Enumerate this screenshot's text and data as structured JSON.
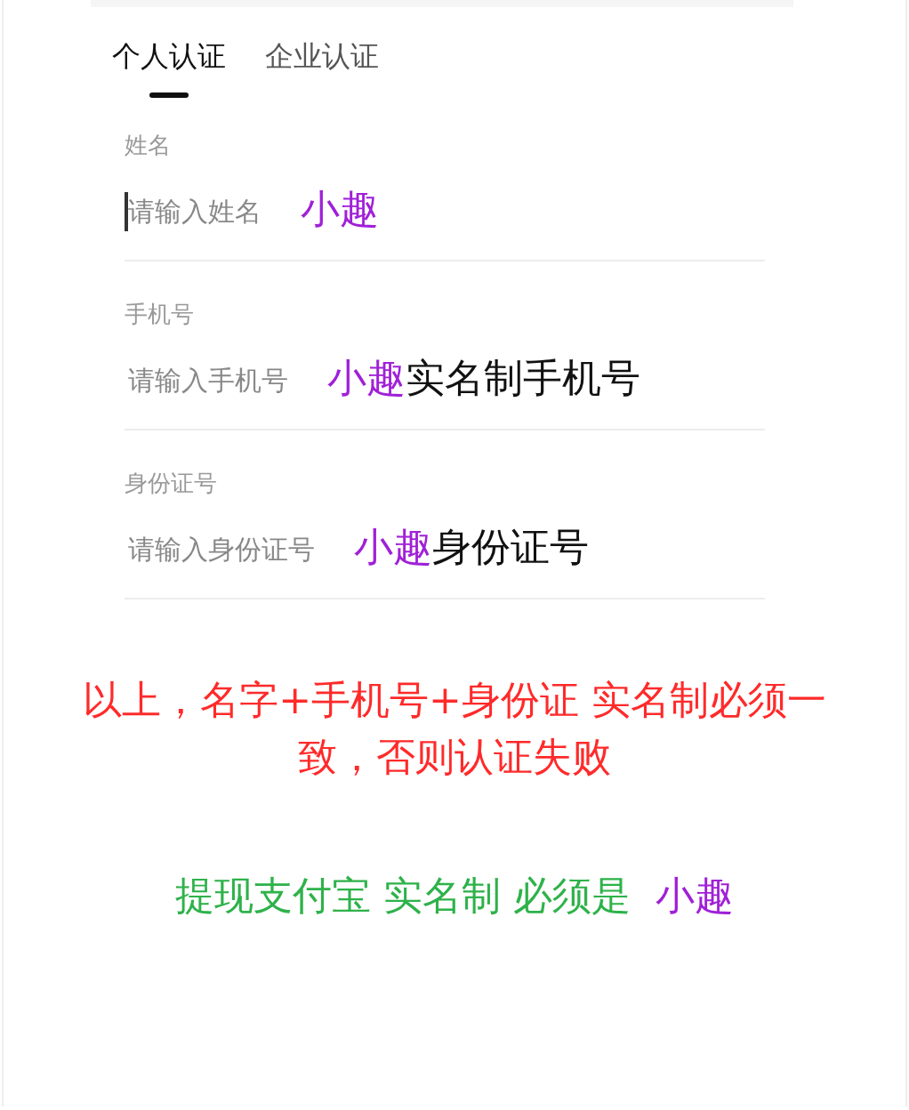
{
  "tabs": [
    {
      "label": "个人认证",
      "selected": true
    },
    {
      "label": "企业认证",
      "selected": false
    }
  ],
  "fields": [
    {
      "label": "姓名",
      "placeholder": "请输入姓名",
      "focused": true,
      "annotation": [
        {
          "text": "小趣",
          "color": "#a020d8"
        }
      ]
    },
    {
      "label": "手机号",
      "placeholder": "请输入手机号",
      "focused": false,
      "annotation": [
        {
          "text": "小趣",
          "color": "#a020d8"
        },
        {
          "text": "实名制手机号",
          "color": "#111111"
        }
      ]
    },
    {
      "label": "身份证号",
      "placeholder": "请输入身份证号",
      "focused": false,
      "annotation": [
        {
          "text": "小趣",
          "color": "#a020d8"
        },
        {
          "text": "身份证号",
          "color": "#111111"
        }
      ]
    }
  ],
  "notes": [
    {
      "parts": [
        {
          "text": "以上，名字+手机号+身份证 实名制必须一致，否则认证失败",
          "color": "#ff2a2a"
        }
      ]
    },
    {
      "parts": [
        {
          "text": "提现支付宝 实名制 必须是",
          "color": "#2eb24a"
        },
        {
          "text": "小趣",
          "color": "#a020d8"
        }
      ]
    }
  ]
}
